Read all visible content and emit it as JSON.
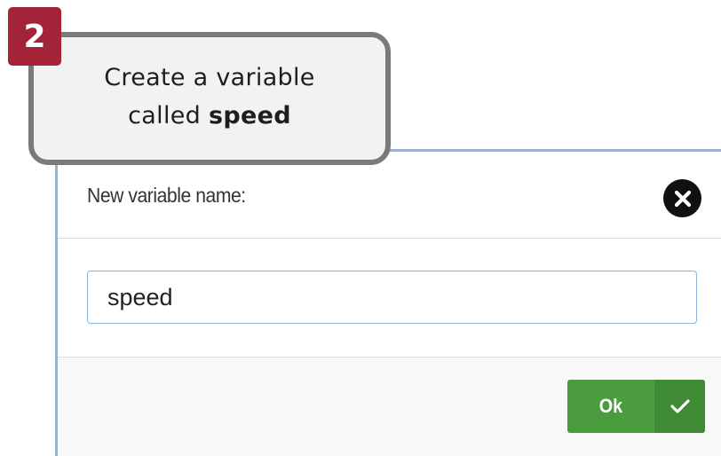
{
  "tutorial": {
    "step_number": "2",
    "instruction_line1": "Create a variable",
    "instruction_line2_prefix": "called ",
    "instruction_line2_emphasis": "speed"
  },
  "dialog": {
    "title": "New variable name:",
    "close_icon": "close-circle-icon",
    "input": {
      "value": "speed"
    },
    "ok_button": {
      "label": "Ok",
      "icon": "checkmark-icon"
    }
  },
  "colors": {
    "badge": "#a2233a",
    "ok_button": "#4a9c3e",
    "dialog_border": "#9eb1cf",
    "callout_border": "#7a7a7a"
  }
}
